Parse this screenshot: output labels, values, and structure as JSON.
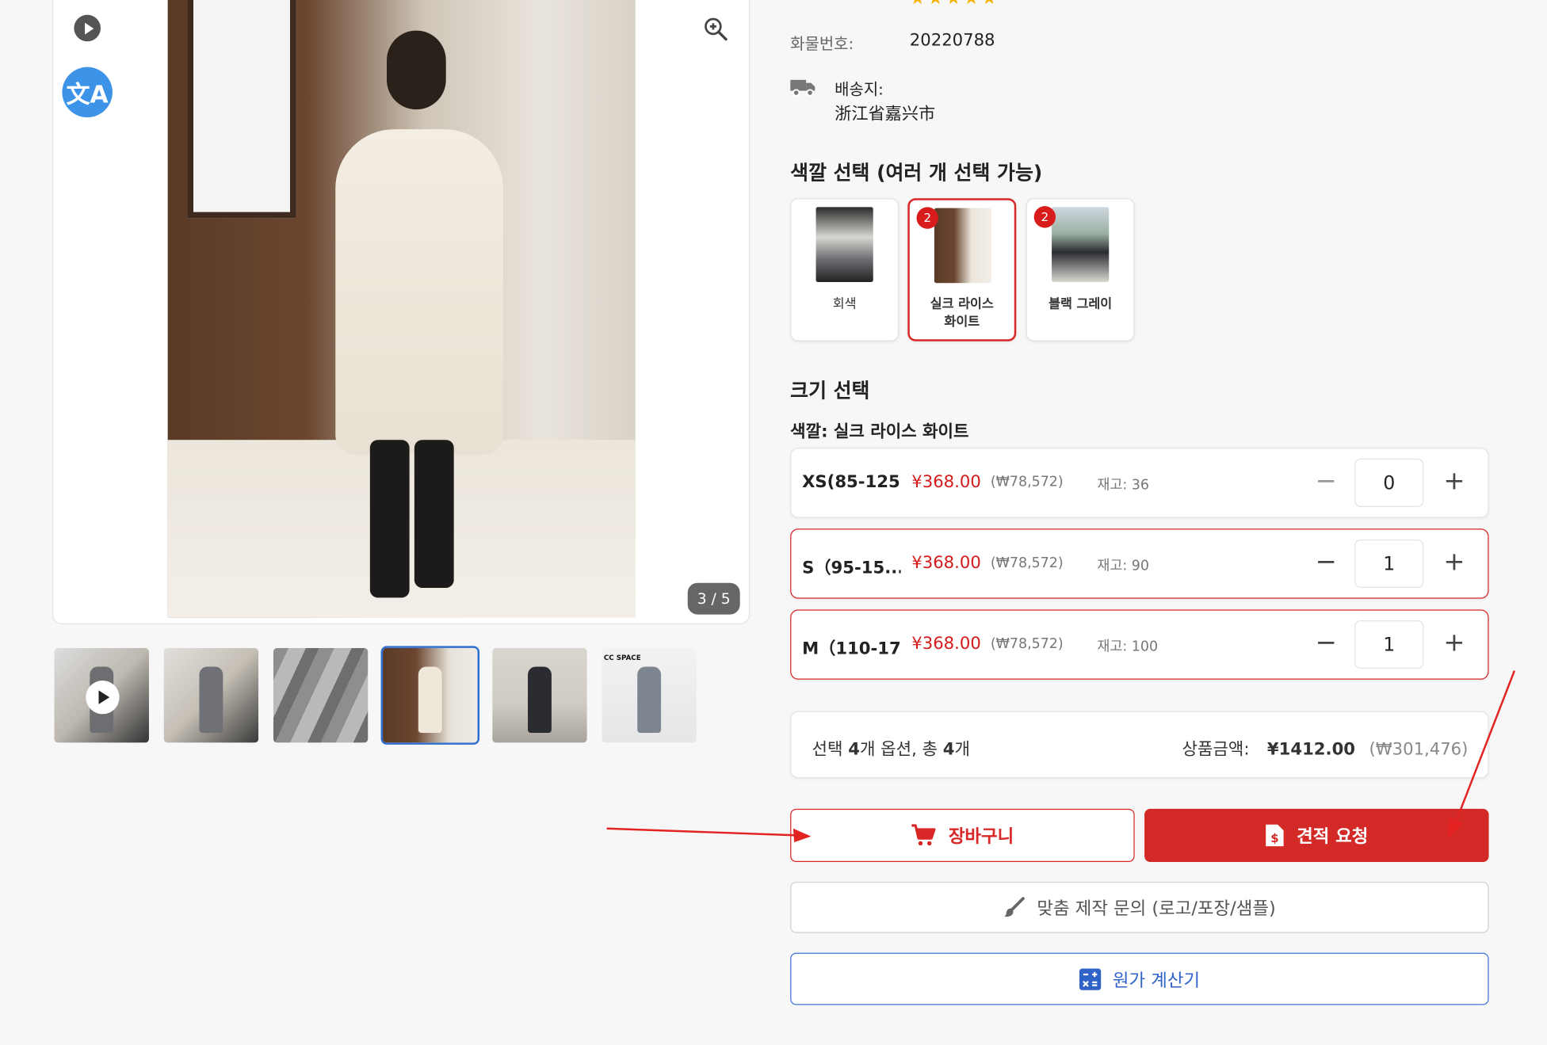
{
  "gallery": {
    "page_counter": "3 / 5",
    "translate_label": "文A",
    "thumbnails": [
      {
        "active": false,
        "has_play": true,
        "text": ""
      },
      {
        "active": false,
        "has_play": false,
        "text": ""
      },
      {
        "active": false,
        "has_play": false,
        "text": ""
      },
      {
        "active": true,
        "has_play": false,
        "text": ""
      },
      {
        "active": false,
        "has_play": false,
        "text": ""
      },
      {
        "active": false,
        "has_play": false,
        "text": "CC SPACE"
      }
    ]
  },
  "product": {
    "rating_stars": "★★★★★",
    "item_number_label": "화물번호:",
    "item_number": "20220788",
    "ship_from_label": "배송지:",
    "ship_from": "浙江省嘉兴市"
  },
  "color_section": {
    "title": "색깔 선택 (여러 개 선택 가능)",
    "options": [
      {
        "label": "회색",
        "count": "",
        "selected": false
      },
      {
        "label": "실크 라이스\n화이트",
        "count": "2",
        "selected": true
      },
      {
        "label": "블랙 그레이",
        "count": "2",
        "selected": false
      }
    ]
  },
  "size_section": {
    "title": "크기 선택",
    "current_color": "색깔: 실크 라이스 화이트",
    "rows": [
      {
        "name": "XS(85-125)",
        "price": "¥368.00",
        "krw": "(₩78,572)",
        "stock": "재고: 36",
        "qty": "0",
        "active": false
      },
      {
        "name": "S（95-15...",
        "price": "¥368.00",
        "krw": "(₩78,572)",
        "stock": "재고: 90",
        "qty": "1",
        "active": true
      },
      {
        "name": "M（110-17...",
        "price": "¥368.00",
        "krw": "(₩78,572)",
        "stock": "재고: 100",
        "qty": "1",
        "active": true
      }
    ]
  },
  "summary": {
    "selection_prefix": "선택 ",
    "option_count": "4",
    "selection_mid": "개 옵션, 총 ",
    "total_count": "4",
    "selection_suffix": "개",
    "amount_label": "상품금액:",
    "amount": "¥1412.00",
    "amount_krw": "(₩301,476)"
  },
  "buttons": {
    "cart": "장바구니",
    "quote": "견적 요청",
    "custom": "맞춤 제작 문의 (로고/포장/샘플)",
    "calculator": "원가 계산기"
  },
  "colors": {
    "accent_red": "#d32a27",
    "accent_blue": "#2f63c7",
    "translate_blue": "#3d93e8",
    "star_gold": "#f5b301"
  }
}
